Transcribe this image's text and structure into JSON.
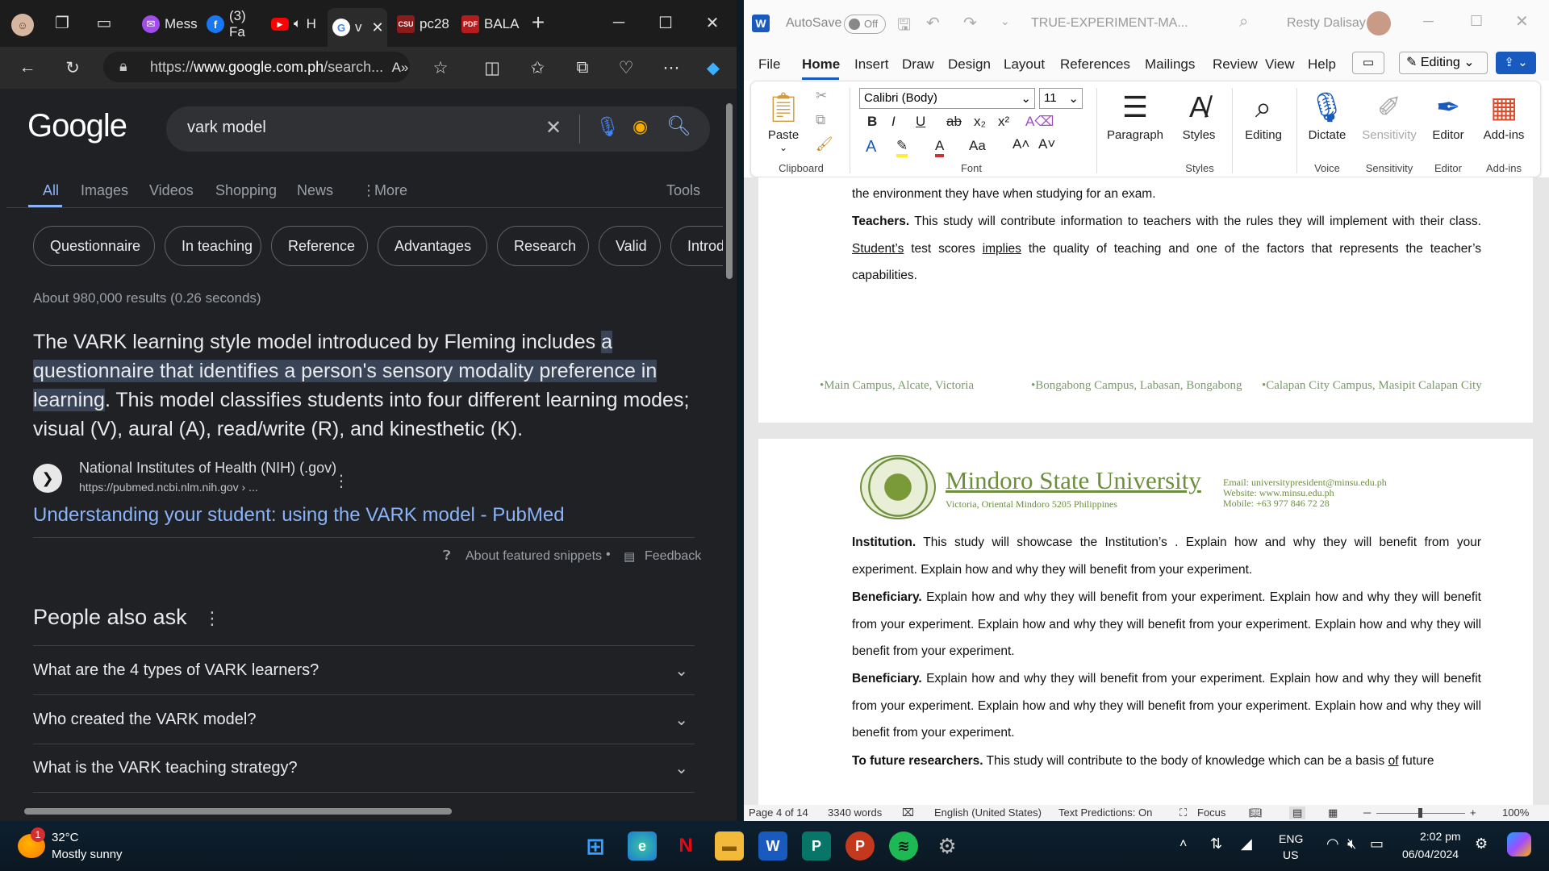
{
  "edge": {
    "tabs": [
      {
        "label": "Mess",
        "icon": "messenger-icon",
        "color": "#a24cf0"
      },
      {
        "label": "(3) Fa",
        "icon": "facebook-icon",
        "color": "#1877f2"
      },
      {
        "label": "H",
        "icon": "youtube-icon",
        "color": "#ff0000"
      },
      {
        "label": "v",
        "icon": "google-icon",
        "color": "#ffffff"
      },
      {
        "label": "pc28",
        "icon": "csu-icon",
        "color": "#8b1a1a"
      },
      {
        "label": "BALA",
        "icon": "pdf-icon",
        "color": "#b71c1c"
      }
    ],
    "url_prefix": "https://",
    "url_domain": "www.google.com.ph",
    "url_rest": "/search..."
  },
  "google": {
    "logo": "Google",
    "query": "vark model",
    "tabs": [
      "All",
      "Images",
      "Videos",
      "Shopping",
      "News",
      "More",
      "Tools"
    ],
    "chips": [
      "Questionnaire",
      "In teaching",
      "Reference",
      "Advantages",
      "Research",
      "Valid",
      "Introd"
    ],
    "stats": "About 980,000 results (0.26 seconds)",
    "snippet_before": "The VARK learning style model introduced by Fleming includes ",
    "snippet_highlight": "a questionnaire that identifies a person's sensory modality preference in learning",
    "snippet_after": ". This model classifies students into four different learning modes; visual (V), aural (A), read/write (R), and kinesthetic (K).",
    "source_name": "National Institutes of Health (NIH) (.gov)",
    "source_url": "https://pubmed.ncbi.nlm.nih.gov › ...",
    "result_title": "Understanding your student: using the VARK model - PubMed",
    "about_snippets": "About featured snippets",
    "feedback": "Feedback",
    "paa_title": "People also ask",
    "paa": [
      "What are the 4 types of VARK learners?",
      "Who created the VARK model?",
      "What is the VARK teaching strategy?"
    ]
  },
  "word": {
    "autosave": "AutoSave",
    "autosave_state": "Off",
    "doc_title": "TRUE-EXPERIMENT-MA...",
    "user": "Resty Dalisay",
    "menu": [
      "File",
      "Home",
      "Insert",
      "Draw",
      "Design",
      "Layout",
      "References",
      "Mailings",
      "Review",
      "View",
      "Help"
    ],
    "editing_mode": "Editing",
    "font_name": "Calibri (Body)",
    "font_size": "11",
    "groups": {
      "clipboard": "Clipboard",
      "font": "Font",
      "styles": "Styles",
      "voice": "Voice",
      "sensitivity": "Sensitivity",
      "editor": "Editor",
      "addins": "Add-ins"
    },
    "buttons": {
      "paste": "Paste",
      "paragraph": "Paragraph",
      "styles": "Styles",
      "editing": "Editing",
      "dictate": "Dictate",
      "sensitivity": "Sensitivity",
      "editor": "Editor",
      "addins": "Add-ins"
    },
    "page1_tail": "the environment they have when studying for an exam.",
    "teachers_label": "Teachers.",
    "teachers_text_a": " This study will contribute information to teachers with the rules they will implement with their class. ",
    "teachers_u1": "Student’s",
    "teachers_text_b": " test scores ",
    "teachers_u2": "implies",
    "teachers_text_c": " the quality of teaching and one of the factors that represents the teacher’s capabilities.",
    "footer": [
      "•Main Campus, Alcate, Victoria",
      "•Bongabong Campus, Labasan, Bongabong",
      "•Calapan City Campus, Masipit Calapan City"
    ],
    "university": "Mindoro State University",
    "address": "Victoria, Oriental Mindoro 5205 Philippines",
    "email": "Email: universitypresident@minsu.edu.ph",
    "website": "Website: www.minsu.edu.ph",
    "mobile": "Mobile: +63 977 846 72 28",
    "institution_label": "Institution.",
    "institution_text": " This study will showcase the Institution’s . Explain how and why they will benefit from your experiment. Explain how and why they will benefit from your experiment.",
    "beneficiary_label": "Beneficiary.",
    "beneficiary_text": " Explain how and why they will benefit from your experiment. Explain how and why they will benefit from your experiment. Explain how and why they will benefit from your experiment. Explain how and why they will benefit from your experiment.",
    "future_label": "To future researchers.",
    "future_text_a": " This study will contribute to the body of knowledge which can be a basis ",
    "future_u": "of",
    "future_text_b": " future",
    "status": {
      "page": "Page 4 of 14",
      "words": "3340 words",
      "lang": "English (United States)",
      "predictions": "Text Predictions: On",
      "focus": "Focus",
      "zoom": "100%"
    }
  },
  "taskbar": {
    "weather_temp": "32°C",
    "weather_desc": "Mostly sunny",
    "weather_badge": "1",
    "lang_top": "ENG",
    "lang_bottom": "US",
    "time": "2:02 pm",
    "date": "06/04/2024"
  }
}
